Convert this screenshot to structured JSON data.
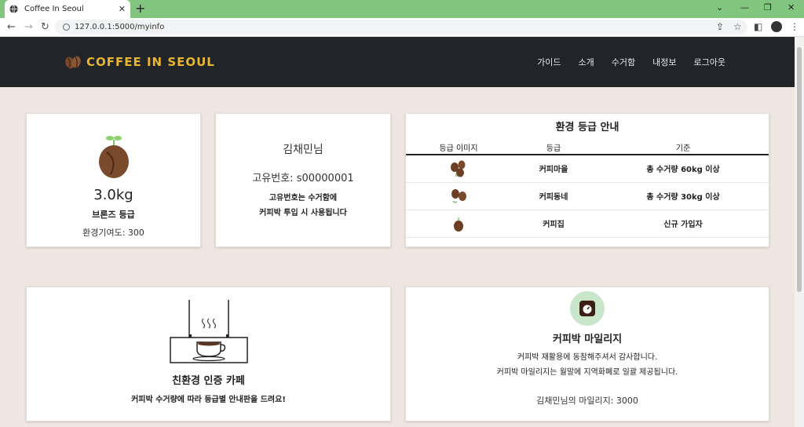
{
  "browser": {
    "tab_title": "Coffee In Seoul",
    "url": "127.0.0.1:5000/myinfo"
  },
  "site": {
    "brand": "COFFEE IN SEOUL",
    "nav": [
      "가이드",
      "소개",
      "수거함",
      "내정보",
      "로그아웃"
    ]
  },
  "profile": {
    "weight": "3.0kg",
    "grade": "브론즈 등급",
    "contribution": "환경기여도: 300"
  },
  "user": {
    "name": "김채민님",
    "id_text": "고유번호: s00000001",
    "note_line1": "고유번호는 수거함에",
    "note_line2": "커피박 투입 시 사용됩니다"
  },
  "grades": {
    "title": "환경 등급 안내",
    "headers": [
      "등급 이미지",
      "등급",
      "기준"
    ],
    "rows": [
      {
        "grade": "커피마을",
        "criteria": "총 수거량 60kg 이상"
      },
      {
        "grade": "커피동네",
        "criteria": "총 수거량 30kg 이상"
      },
      {
        "grade": "커피집",
        "criteria": "신규 가입자"
      }
    ]
  },
  "cafe": {
    "title": "친환경 인증 카페",
    "desc": "커피박 수거량에 따라 등급별 안내판을 드려요!"
  },
  "mileage": {
    "title": "커피박 마일리지",
    "line1": "커피박 재활용에 동참해주셔서 감사합니다.",
    "line2": "커피박 마일리지는 월말에 지역화폐로 일괄 제공됩니다.",
    "user_line": "김채민님의 마일리지: 3000"
  },
  "colors": {
    "brand": "#e9b42f",
    "navbar": "#212529",
    "page_bg": "#efe6e1",
    "tabbar": "#82c57e"
  }
}
